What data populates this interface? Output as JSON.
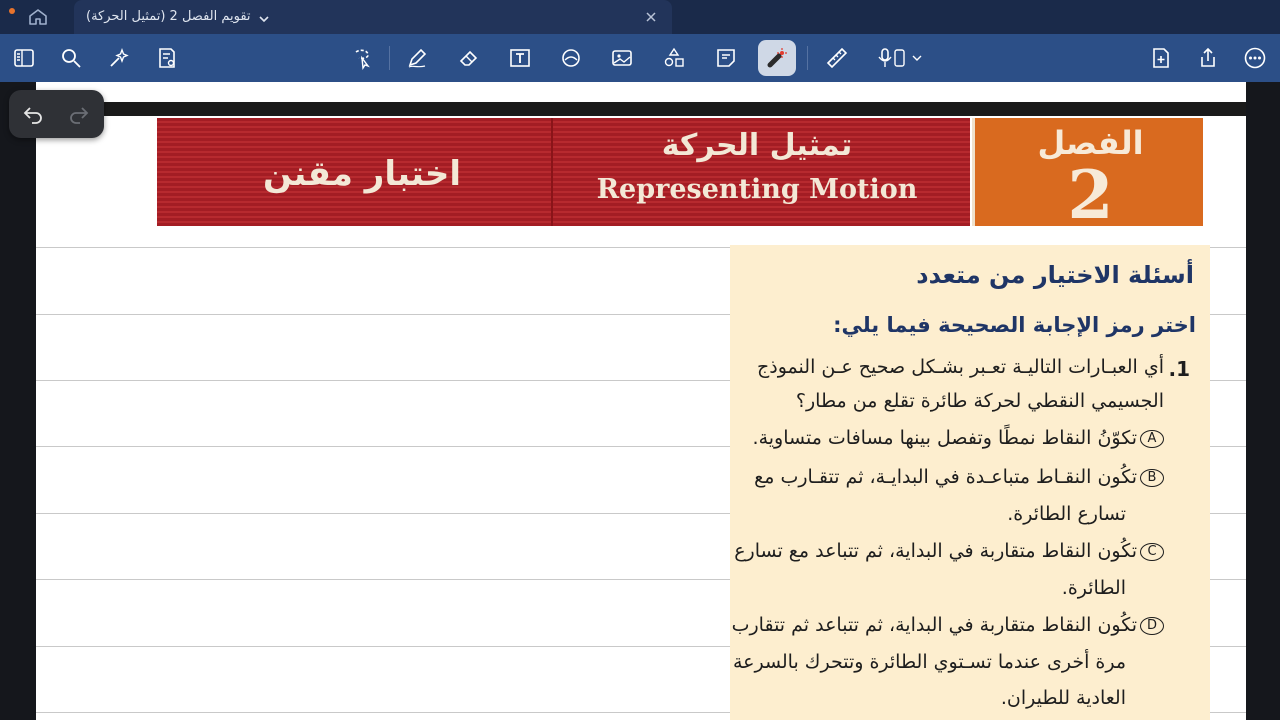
{
  "tab": {
    "title": "تقويم الفصل 2 (تمثيل الحركة)"
  },
  "toolbar": {
    "left_icons": [
      "sidebar-icon",
      "search-icon",
      "ai-sparkle-icon",
      "document-settings-icon"
    ],
    "tool_icons": [
      "lasso-select-icon",
      "pen-icon",
      "eraser-icon",
      "text-box-icon",
      "shapes-icon",
      "image-icon",
      "elements-icon",
      "sticky-note-icon",
      "laser-pointer-icon",
      "ruler-icon",
      "audio-record-icon"
    ],
    "right_icons": [
      "add-page-icon",
      "share-icon",
      "more-icon"
    ],
    "active_tool": "laser-pointer-icon",
    "accent": "#2c4f87"
  },
  "banner": {
    "test_label": "اختبار مقنن",
    "title_ar": "تمثيل الحركة",
    "title_en": "Representing Motion",
    "chapter_word": "الفصل",
    "chapter_number": "2",
    "red_color": "#a31d24",
    "orange_color": "#d96a1f"
  },
  "questions": {
    "heading": "أسئلة الاختيار من متعدد",
    "instruction": "اختر رمز الإجابة الصحيحة فيما يلي:",
    "q1": {
      "number": ".1",
      "lines": [
        "أي العبـارات التاليـة تعـبر بشـكل صحيح عـن النموذج",
        "الجسيمي النقطي لحركة طائرة تقلع من مطار؟"
      ],
      "options": [
        {
          "letter": "A",
          "lines": [
            "تكوّنُ النقاط نمطًا وتفصل بينها مسافات متساوية."
          ]
        },
        {
          "letter": "B",
          "lines": [
            "تكُون النقـاط متباعـدة في البدايـة، ثم تتقـارب مع",
            "تسارع الطائرة."
          ]
        },
        {
          "letter": "C",
          "lines": [
            "تكُون النقاط متقاربة في البداية، ثم تتباعد مع تسارع",
            "الطائرة."
          ]
        },
        {
          "letter": "D",
          "lines": [
            "تكُون النقاط متقاربة في البداية، ثم تتباعد ثم تتقارب",
            "مرة أخرى عندما تسـتوي الطائرة وتتحرك بالسرعة",
            "العادية للطيران."
          ]
        }
      ]
    }
  }
}
